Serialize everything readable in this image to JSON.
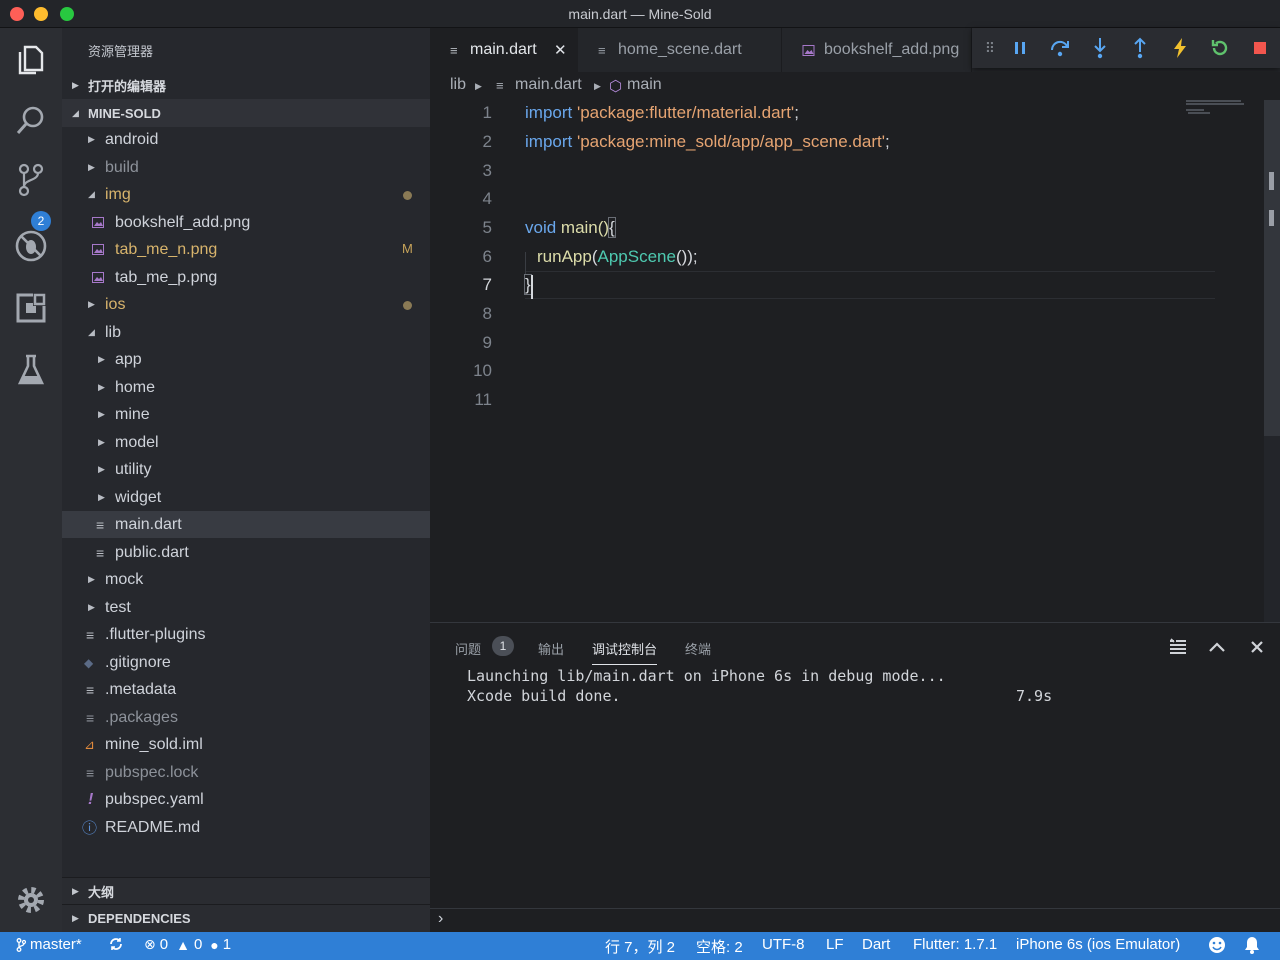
{
  "window": {
    "title": "main.dart — Mine-Sold"
  },
  "activity": {
    "scm_badge": "2"
  },
  "sidebar": {
    "header": "资源管理器",
    "open_editors": "打开的编辑器",
    "project": "MINE-SOLD",
    "outline": "大纲",
    "dependencies": "DEPENDENCIES",
    "files": [
      {
        "label": "android"
      },
      {
        "label": "build"
      },
      {
        "label": "img"
      },
      {
        "label": "bookshelf_add.png"
      },
      {
        "label": "tab_me_n.png",
        "flag": "M"
      },
      {
        "label": "tab_me_p.png"
      },
      {
        "label": "ios"
      },
      {
        "label": "lib"
      },
      {
        "label": "app"
      },
      {
        "label": "home"
      },
      {
        "label": "mine"
      },
      {
        "label": "model"
      },
      {
        "label": "utility"
      },
      {
        "label": "widget"
      },
      {
        "label": "main.dart"
      },
      {
        "label": "public.dart"
      },
      {
        "label": "mock"
      },
      {
        "label": "test"
      },
      {
        "label": ".flutter-plugins"
      },
      {
        "label": ".gitignore"
      },
      {
        "label": ".metadata"
      },
      {
        "label": ".packages"
      },
      {
        "label": "mine_sold.iml"
      },
      {
        "label": "pubspec.lock"
      },
      {
        "label": "pubspec.yaml"
      },
      {
        "label": "README.md"
      }
    ]
  },
  "tabs": [
    {
      "label": "main.dart"
    },
    {
      "label": "home_scene.dart"
    },
    {
      "label": "bookshelf_add.png"
    }
  ],
  "breadcrumb": {
    "folder": "lib",
    "file": "main.dart",
    "symbol": "main"
  },
  "editor": {
    "line_numbers": [
      "1",
      "2",
      "3",
      "4",
      "5",
      "6",
      "7",
      "8",
      "9",
      "10",
      "11"
    ],
    "lines": {
      "l1_kw": "import",
      "l1_str": "'package:flutter/material.dart'",
      "l1_end": ";",
      "l2_kw": "import",
      "l2_str": "'package:mine_sold/app/app_scene.dart'",
      "l2_end": ";",
      "l5_kw": "void",
      "l5_fn": " main()",
      "l5_brace": "{",
      "l6_fn": "runApp",
      "l6_open": "(",
      "l6_cls": "AppScene",
      "l6_end": "());",
      "l7_brace": "}"
    }
  },
  "panel": {
    "tabs": [
      "问题",
      "输出",
      "调试控制台",
      "终端"
    ],
    "problems_count": "1",
    "output": [
      {
        "text": "Launching lib/main.dart on iPhone 6s in debug mode..."
      },
      {
        "text": "Xcode build done.",
        "time": "7.9s"
      }
    ],
    "prompt": "›"
  },
  "status": {
    "branch": "master*",
    "errors": "0",
    "warnings": "0",
    "infos": "1",
    "position": "行 7，列 2",
    "spaces": "空格: 2",
    "encoding": "UTF-8",
    "eol": "LF",
    "language": "Dart",
    "flutter": "Flutter: 1.7.1",
    "device": "iPhone 6s (ios Emulator)"
  },
  "colors": {
    "accent": "#2f7fd6",
    "sidebar": "#26282d",
    "editor": "#1e1f22"
  }
}
